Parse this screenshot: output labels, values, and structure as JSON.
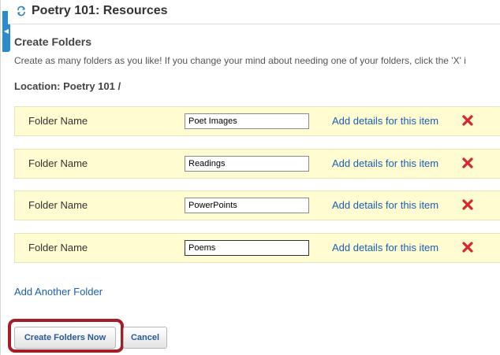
{
  "header": {
    "title": "Poetry 101: Resources",
    "icon": "refresh-arrows-icon"
  },
  "section": {
    "title": "Create Folders",
    "instructions": "Create as many folders as you like! If you change your mind about needing one of your folders, click the 'X' i",
    "location": "Location: Poetry 101 /"
  },
  "folders": [
    {
      "label": "Folder Name",
      "value": "Poet Images",
      "details_link": "Add details for this item"
    },
    {
      "label": "Folder Name",
      "value": "Readings",
      "details_link": "Add details for this item"
    },
    {
      "label": "Folder Name",
      "value": "PowerPoints",
      "details_link": "Add details for this item"
    },
    {
      "label": "Folder Name",
      "value": "Poems",
      "details_link": "Add details for this item"
    }
  ],
  "add_folder_label": "Add Another Folder",
  "buttons": {
    "create": "Create Folders Now",
    "cancel": "Cancel"
  },
  "colors": {
    "row_background": "#fefcd0",
    "link": "#1a5fb4",
    "delete_icon": "#d9262c",
    "highlight_border": "#a41e28",
    "collapse_tab": "#2a8bd0"
  }
}
